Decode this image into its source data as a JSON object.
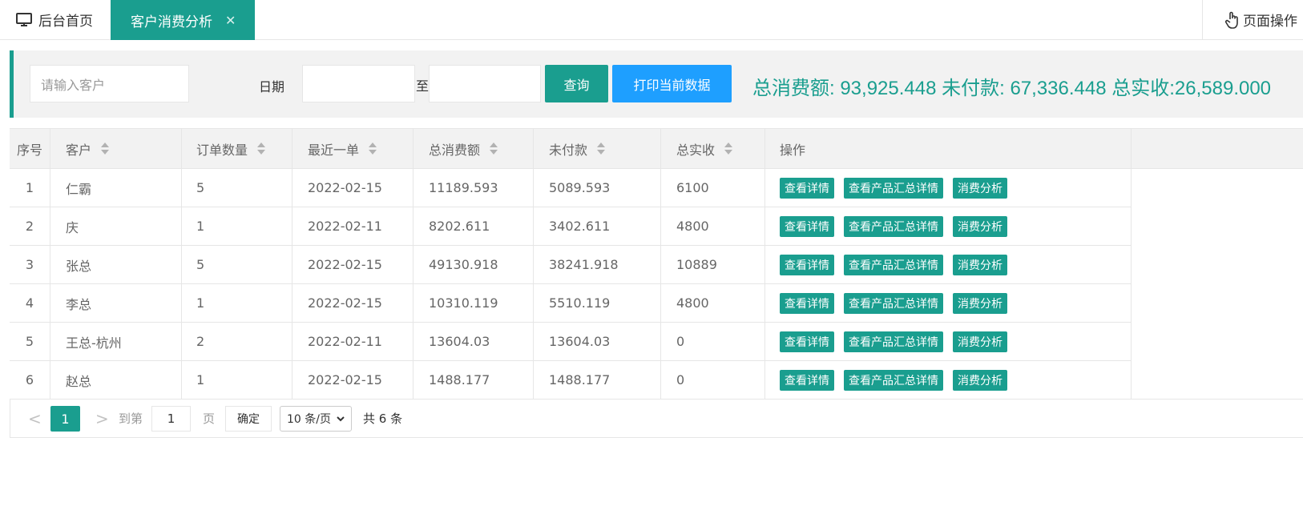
{
  "tabs": {
    "home_label": "后台首页",
    "active_label": "客户消费分析",
    "close_glyph": "✕",
    "page_ops_label": "页面操作"
  },
  "filter": {
    "customer_placeholder": "请输入客户",
    "date_label": "日期",
    "to_label": "至",
    "query_label": "查询",
    "print_label": "打印当前数据",
    "summary": "总消费额: 93,925.448 未付款: 67,336.448 总实收:26,589.000"
  },
  "table": {
    "headers": [
      "序号",
      "客户",
      "订单数量",
      "最近一单",
      "总消费额",
      "未付款",
      "总实收",
      "操作"
    ],
    "actions": [
      "查看详情",
      "查看产品汇总详情",
      "消费分析"
    ],
    "rows": [
      [
        "1",
        "仁霸",
        "5",
        "2022-02-15",
        "11189.593",
        "5089.593",
        "6100"
      ],
      [
        "2",
        "庆",
        "1",
        "2022-02-11",
        "8202.611",
        "3402.611",
        "4800"
      ],
      [
        "3",
        "张总",
        "5",
        "2022-02-15",
        "49130.918",
        "38241.918",
        "10889"
      ],
      [
        "4",
        "李总",
        "1",
        "2022-02-15",
        "10310.119",
        "5510.119",
        "4800"
      ],
      [
        "5",
        "王总-杭州",
        "2",
        "2022-02-11",
        "13604.03",
        "13604.03",
        "0"
      ],
      [
        "6",
        "赵总",
        "1",
        "2022-02-15",
        "1488.177",
        "1488.177",
        "0"
      ]
    ]
  },
  "pager": {
    "prev": "<",
    "current_page": "1",
    "next": ">",
    "goto_label": "到第",
    "goto_value": "1",
    "page_unit": "页",
    "confirm_label": "确定",
    "page_size": "10 条/页",
    "total": "共 6 条"
  },
  "colors": {
    "accent": "#1a9e8f",
    "print": "#1e9fff"
  }
}
